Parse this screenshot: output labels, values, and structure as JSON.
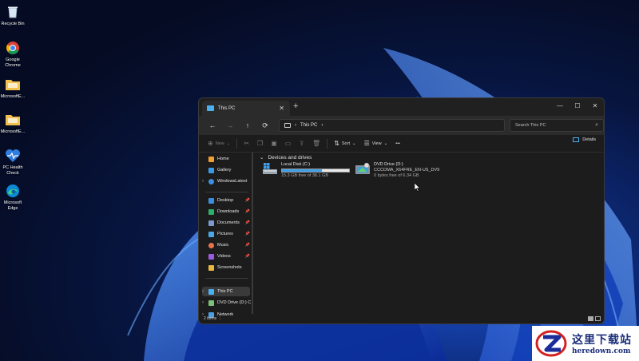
{
  "desktop": {
    "icons": [
      {
        "label": "Recycle Bin",
        "icon": "recycle-bin-icon"
      },
      {
        "label": "Google Chrome",
        "icon": "chrome-icon"
      },
      {
        "label": "MicrosoftE...",
        "icon": "folder-icon"
      },
      {
        "label": "MicrosoftE...",
        "icon": "folder-icon"
      },
      {
        "label": "PC Health Check",
        "icon": "health-check-icon"
      },
      {
        "label": "Microsoft Edge",
        "icon": "edge-icon"
      }
    ]
  },
  "explorer": {
    "tab_title": "This PC",
    "address_path": "This PC",
    "search_placeholder": "Search This PC",
    "commands": {
      "new": "New",
      "sort": "Sort",
      "view": "View",
      "more": "•••",
      "details": "Details"
    },
    "sidebar": {
      "home": "Home",
      "gallery": "Gallery",
      "user": "WindowsLatest",
      "desktop": "Desktop",
      "downloads": "Downloads",
      "documents": "Documents",
      "pictures": "Pictures",
      "music": "Music",
      "videos": "Videos",
      "screenshots": "Screenshots",
      "this_pc": "This PC",
      "dvd_drive": "DVD Drive (D:) C",
      "network": "Network"
    },
    "section_title": "Devices and drives",
    "drives": [
      {
        "name": "Local Disk (C:)",
        "free_text": "15.3 GB free of 38.1 GB",
        "used_fraction": 0.6
      },
      {
        "name": "DVD Drive (D:)",
        "label": "CCCOMA_X64FRE_EN-US_DV9",
        "free_text": "0 bytes free of 6.34 GB"
      }
    ],
    "status": "2 items",
    "accent_color": "#3f9ee8"
  },
  "watermark": {
    "title": "这里下载站",
    "url": "heredown.com"
  }
}
